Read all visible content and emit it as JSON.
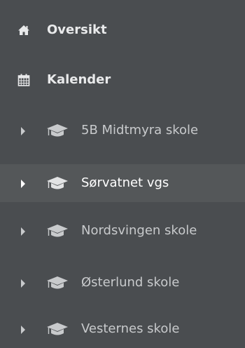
{
  "nav": {
    "top_items": [
      {
        "label": "Oversikt",
        "icon": "home-icon"
      },
      {
        "label": "Kalender",
        "icon": "calendar-icon"
      }
    ],
    "schools": [
      {
        "label": "5B Midtmyra skole",
        "icon": "graduation-cap-icon",
        "active": false
      },
      {
        "label": "Sørvatnet vgs",
        "icon": "graduation-cap-icon",
        "active": true
      },
      {
        "label": "Nordsvingen skole",
        "icon": "graduation-cap-icon",
        "active": false
      },
      {
        "label": "Østerlund skole",
        "icon": "graduation-cap-icon",
        "active": false
      },
      {
        "label": "Vesternes skole",
        "icon": "graduation-cap-icon",
        "active": false
      }
    ]
  },
  "colors": {
    "background": "#4a4d50",
    "active_background": "#545759",
    "text": "#c8cacc",
    "active_text": "#ffffff"
  }
}
